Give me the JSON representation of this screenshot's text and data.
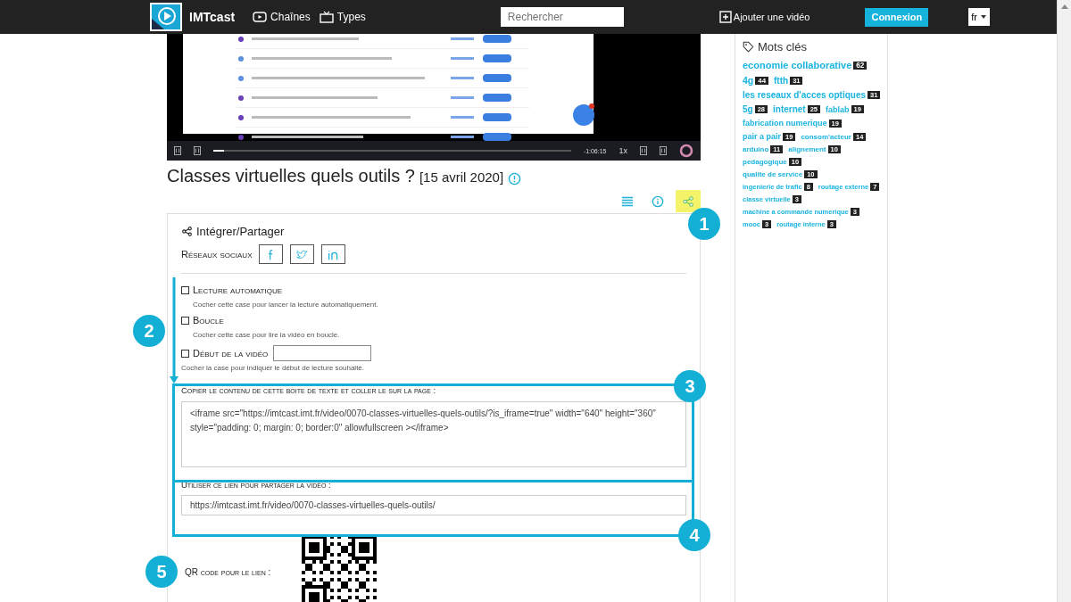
{
  "header": {
    "brand": "IMTcast",
    "nav": [
      {
        "label": "Chaînes",
        "kind": "video"
      },
      {
        "label": "Types",
        "kind": "tv"
      }
    ],
    "search": {
      "placeholder": "Rechercher"
    },
    "add_video": "Ajouter une vidéo",
    "login": "Connexion",
    "language": "fr"
  },
  "video": {
    "time": "-1:06:15",
    "speed": "1x",
    "level": 0.03
  },
  "title": "Classes virtuelles quels outils ?",
  "date": "[15 avril 2020]",
  "toolbar": [
    {
      "kind": "list",
      "selected": false
    },
    {
      "kind": "info",
      "selected": false
    },
    {
      "kind": "share",
      "selected": true
    }
  ],
  "share": {
    "title": "Intégrer/Partager",
    "social_label": "Réseaux sociaux",
    "social": [
      {
        "kind": "facebook"
      },
      {
        "kind": "twitter"
      },
      {
        "kind": "linkedin"
      }
    ],
    "options": [
      {
        "kind": "checkbox",
        "label": "Lecture automatique",
        "checked": false,
        "help": "Cocher cette case pour lancer la lecture automatiquement."
      },
      {
        "kind": "checkbox",
        "label": "Boucle",
        "checked": false,
        "help": "Cocher cette case pour lire la vidéo en boucle."
      },
      {
        "kind": "checkbox-field",
        "label": "Début de la vidéo",
        "checked": false,
        "help": "Cocher la case pour indiquer le début de lecture souhaité."
      }
    ],
    "embed_label": "Copier le contenu de cette boite de texte et coller le sur la page :",
    "embed_code": "<iframe src=\"https://imtcast.imt.fr/video/0070-classes-virtuelles-quels-outils/?is_iframe=true\" width=\"640\" height=\"360\" style=\"padding: 0; margin: 0; border:0\" allowfullscreen ></iframe>",
    "link_label": "Utiliser ce lien pour partager la vidéo :",
    "link": "https://imtcast.imt.fr/video/0070-classes-virtuelles-quels-outils/",
    "qr_label": "QR code pour le lien :"
  },
  "keywords": {
    "title": "Mots clés",
    "tags": [
      {
        "name": "economie collaborative",
        "count": "62"
      },
      {
        "name": "4g",
        "count": "44"
      },
      {
        "name": "ftth",
        "count": "31"
      },
      {
        "name": "les reseaux d'acces optiques",
        "count": "31"
      },
      {
        "name": "5g",
        "count": "28"
      },
      {
        "name": "internet",
        "count": "25"
      },
      {
        "name": "fablab",
        "count": "19"
      },
      {
        "name": "fabrication numerique",
        "count": "19"
      },
      {
        "name": "pair a pair",
        "count": "19"
      },
      {
        "name": "consom'acteur",
        "count": "14"
      },
      {
        "name": "arduino",
        "count": "11"
      },
      {
        "name": "alignement",
        "count": "10"
      },
      {
        "name": "pedagogique",
        "count": "10"
      },
      {
        "name": "qualite de service",
        "count": "10"
      },
      {
        "name": "ingenierie de trafic",
        "count": "8"
      },
      {
        "name": "routage externe",
        "count": "7"
      },
      {
        "name": "classe virtuelle",
        "count": "3"
      },
      {
        "name": "machine a commande numerique",
        "count": "3"
      },
      {
        "name": "mooc",
        "count": "3"
      },
      {
        "name": "routage interne",
        "count": "3"
      }
    ]
  },
  "annotations": [
    {
      "label": "1",
      "kind": "circle"
    },
    {
      "label": "2",
      "kind": "circle"
    },
    {
      "label": "3",
      "kind": "circle"
    },
    {
      "label": "4",
      "kind": "circle"
    },
    {
      "label": "5",
      "kind": "circle"
    }
  ]
}
